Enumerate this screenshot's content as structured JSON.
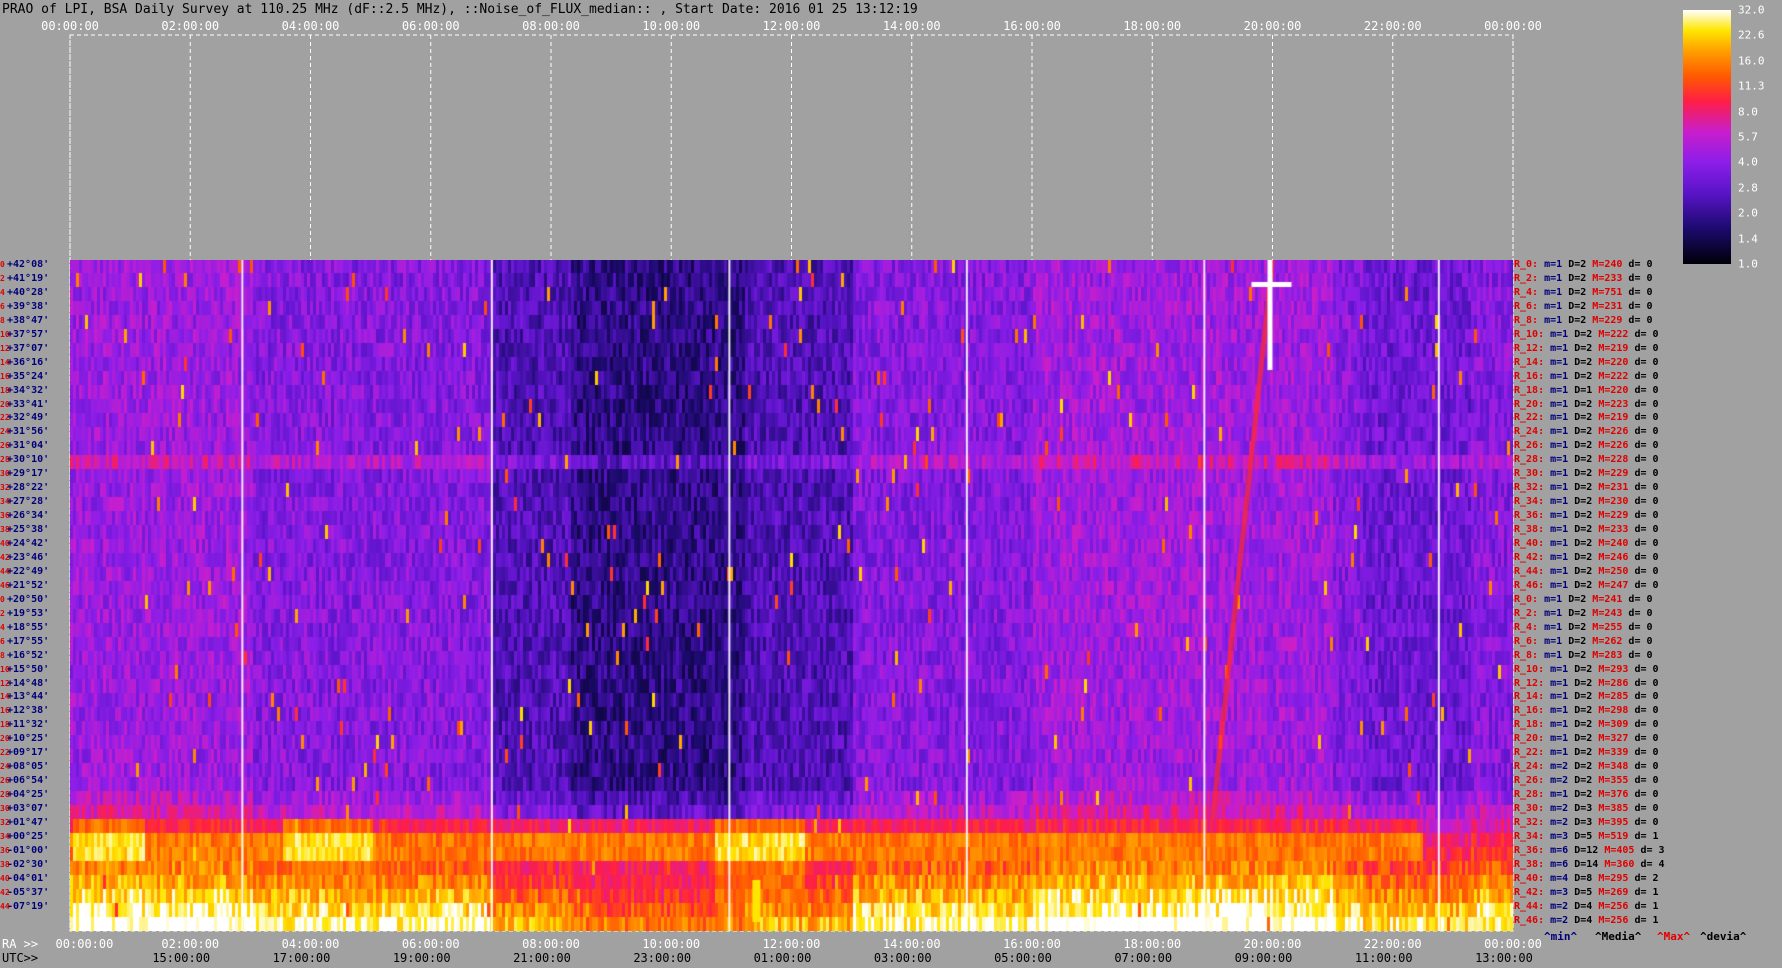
{
  "title": "PRAO of LPI, BSA Daily Survey at 110.25 MHz (dF::2.5 MHz), ::Noise_of_FLUX_median:: , Start Date: 2016 01 25 13:12:19",
  "top_axis_ticks": [
    "00:00:00",
    "02:00:00",
    "04:00:00",
    "06:00:00",
    "08:00:00",
    "10:00:00",
    "12:00:00",
    "14:00:00",
    "16:00:00",
    "18:00:00",
    "20:00:00",
    "22:00:00",
    "00:00:00"
  ],
  "bottom_ra_label": "RA >>",
  "bottom_utc_label": "UTC>>",
  "bottom_ra_ticks": [
    "00:00:00",
    "02:00:00",
    "04:00:00",
    "06:00:00",
    "08:00:00",
    "10:00:00",
    "12:00:00",
    "14:00:00",
    "16:00:00",
    "18:00:00",
    "20:00:00",
    "22:00:00",
    "00:00:00"
  ],
  "bottom_utc_ticks": [
    "15:00:00",
    "17:00:00",
    "19:00:00",
    "21:00:00",
    "23:00:00",
    "01:00:00",
    "03:00:00",
    "05:00:00",
    "07:00:00",
    "09:00:00",
    "11:00:00",
    "13:00:00"
  ],
  "colorbar": {
    "ticks": [
      "32.0",
      "22.6",
      "16.0",
      "11.3",
      "8.0",
      "5.7",
      "4.0",
      "2.8",
      "2.0",
      "1.4",
      "1.0"
    ]
  },
  "stats_legend": {
    "min": "^min^",
    "median": "^Media^",
    "max": "^Max^",
    "dev": "^devia^"
  },
  "chart_data": {
    "type": "heatmap",
    "title": "PRAO of LPI, BSA Daily Survey at 110.25 MHz (dF::2.5 MHz), ::Noise_of_FLUX_median:: , Start Date: 2016 01 25 13:12:19",
    "x_range_ra_hours": [
      0,
      24
    ],
    "colorscale": "black-blue-purple-red-orange-yellow-white",
    "color_range": [
      1.0,
      32.0
    ],
    "declinations": [
      "+42°08'",
      "+41°19'",
      "+40°28'",
      "+39°38'",
      "+38°47'",
      "+37°57'",
      "+37°07'",
      "+36°16'",
      "+35°24'",
      "+34°32'",
      "+33°41'",
      "+32°49'",
      "+31°56'",
      "+31°04'",
      "+30°10'",
      "+29°17'",
      "+28°22'",
      "+27°28'",
      "+26°34'",
      "+25°38'",
      "+24°42'",
      "+23°46'",
      "+22°49'",
      "+21°52'",
      "+20°50'",
      "+19°53'",
      "+18°55'",
      "+17°55'",
      "+16°52'",
      "+15°50'",
      "+14°48'",
      "+13°44'",
      "+12°38'",
      "+11°32'",
      "+10°25'",
      "+09°17'",
      "+08°05'",
      "+06°54'",
      "+04°25'",
      "+03°07'",
      "+01°47'",
      "+00°25'",
      "-01°00'",
      "-02°30'",
      "-04°01'",
      "-05°37'",
      "-07°19'"
    ],
    "row_index_labels": [
      "0",
      "2",
      "4",
      "6",
      "8",
      "10",
      "12",
      "14",
      "16",
      "18",
      "20",
      "22",
      "24",
      "26",
      "28",
      "30",
      "32",
      "34",
      "36",
      "38",
      "40",
      "42",
      "44",
      "46",
      "0",
      "2",
      "4",
      "6",
      "8",
      "10",
      "12",
      "14",
      "16",
      "18",
      "20",
      "22",
      "24",
      "26",
      "28",
      "30",
      "32",
      "34",
      "36",
      "38",
      "40",
      "42",
      "44",
      "46"
    ],
    "row_stats": [
      {
        "r": "R_0:",
        "min": "1",
        "med": "2",
        "max": "240",
        "dev": "0"
      },
      {
        "r": "R_2:",
        "min": "1",
        "med": "2",
        "max": "233",
        "dev": "0"
      },
      {
        "r": "R_4:",
        "min": "1",
        "med": "2",
        "max": "751",
        "dev": "0"
      },
      {
        "r": "R_6:",
        "min": "1",
        "med": "2",
        "max": "231",
        "dev": "0"
      },
      {
        "r": "R_8:",
        "min": "1",
        "med": "2",
        "max": "229",
        "dev": "0"
      },
      {
        "r": "R_10:",
        "min": "1",
        "med": "2",
        "max": "222",
        "dev": "0"
      },
      {
        "r": "R_12:",
        "min": "1",
        "med": "2",
        "max": "219",
        "dev": "0"
      },
      {
        "r": "R_14:",
        "min": "1",
        "med": "2",
        "max": "220",
        "dev": "0"
      },
      {
        "r": "R_16:",
        "min": "1",
        "med": "2",
        "max": "222",
        "dev": "0"
      },
      {
        "r": "R_18:",
        "min": "1",
        "med": "1",
        "max": "220",
        "dev": "0"
      },
      {
        "r": "R_20:",
        "min": "1",
        "med": "2",
        "max": "223",
        "dev": "0"
      },
      {
        "r": "R_22:",
        "min": "1",
        "med": "2",
        "max": "219",
        "dev": "0"
      },
      {
        "r": "R_24:",
        "min": "1",
        "med": "2",
        "max": "226",
        "dev": "0"
      },
      {
        "r": "R_26:",
        "min": "1",
        "med": "2",
        "max": "226",
        "dev": "0"
      },
      {
        "r": "R_28:",
        "min": "1",
        "med": "2",
        "max": "228",
        "dev": "0"
      },
      {
        "r": "R_30:",
        "min": "1",
        "med": "2",
        "max": "229",
        "dev": "0"
      },
      {
        "r": "R_32:",
        "min": "1",
        "med": "2",
        "max": "231",
        "dev": "0"
      },
      {
        "r": "R_34:",
        "min": "1",
        "med": "2",
        "max": "230",
        "dev": "0"
      },
      {
        "r": "R_36:",
        "min": "1",
        "med": "2",
        "max": "229",
        "dev": "0"
      },
      {
        "r": "R_38:",
        "min": "1",
        "med": "2",
        "max": "233",
        "dev": "0"
      },
      {
        "r": "R_40:",
        "min": "1",
        "med": "2",
        "max": "240",
        "dev": "0"
      },
      {
        "r": "R_42:",
        "min": "1",
        "med": "2",
        "max": "246",
        "dev": "0"
      },
      {
        "r": "R_44:",
        "min": "1",
        "med": "2",
        "max": "250",
        "dev": "0"
      },
      {
        "r": "R_46:",
        "min": "1",
        "med": "2",
        "max": "247",
        "dev": "0"
      },
      {
        "r": "R_0:",
        "min": "1",
        "med": "2",
        "max": "241",
        "dev": "0"
      },
      {
        "r": "R_2:",
        "min": "1",
        "med": "2",
        "max": "243",
        "dev": "0"
      },
      {
        "r": "R_4:",
        "min": "1",
        "med": "2",
        "max": "255",
        "dev": "0"
      },
      {
        "r": "R_6:",
        "min": "1",
        "med": "2",
        "max": "262",
        "dev": "0"
      },
      {
        "r": "R_8:",
        "min": "1",
        "med": "2",
        "max": "283",
        "dev": "0"
      },
      {
        "r": "R_10:",
        "min": "1",
        "med": "2",
        "max": "293",
        "dev": "0"
      },
      {
        "r": "R_12:",
        "min": "1",
        "med": "2",
        "max": "286",
        "dev": "0"
      },
      {
        "r": "R_14:",
        "min": "1",
        "med": "2",
        "max": "285",
        "dev": "0"
      },
      {
        "r": "R_16:",
        "min": "1",
        "med": "2",
        "max": "298",
        "dev": "0"
      },
      {
        "r": "R_18:",
        "min": "1",
        "med": "2",
        "max": "309",
        "dev": "0"
      },
      {
        "r": "R_20:",
        "min": "1",
        "med": "2",
        "max": "327",
        "dev": "0"
      },
      {
        "r": "R_22:",
        "min": "1",
        "med": "2",
        "max": "339",
        "dev": "0"
      },
      {
        "r": "R_24:",
        "min": "2",
        "med": "2",
        "max": "348",
        "dev": "0"
      },
      {
        "r": "R_26:",
        "min": "2",
        "med": "2",
        "max": "355",
        "dev": "0"
      },
      {
        "r": "R_28:",
        "min": "1",
        "med": "2",
        "max": "376",
        "dev": "0"
      },
      {
        "r": "R_30:",
        "min": "2",
        "med": "3",
        "max": "385",
        "dev": "0"
      },
      {
        "r": "R_32:",
        "min": "2",
        "med": "3",
        "max": "395",
        "dev": "0"
      },
      {
        "r": "R_34:",
        "min": "3",
        "med": "5",
        "max": "519",
        "dev": "1"
      },
      {
        "r": "R_36:",
        "min": "6",
        "med": "12",
        "max": "405",
        "dev": "3"
      },
      {
        "r": "R_38:",
        "min": "6",
        "med": "14",
        "max": "360",
        "dev": "4"
      },
      {
        "r": "R_40:",
        "min": "4",
        "med": "8",
        "max": "295",
        "dev": "2"
      },
      {
        "r": "R_42:",
        "min": "3",
        "med": "5",
        "max": "269",
        "dev": "1"
      },
      {
        "r": "R_44:",
        "min": "2",
        "med": "4",
        "max": "256",
        "dev": "1"
      },
      {
        "r": "R_46:",
        "min": "2",
        "med": "4",
        "max": "256",
        "dev": "1"
      }
    ]
  }
}
